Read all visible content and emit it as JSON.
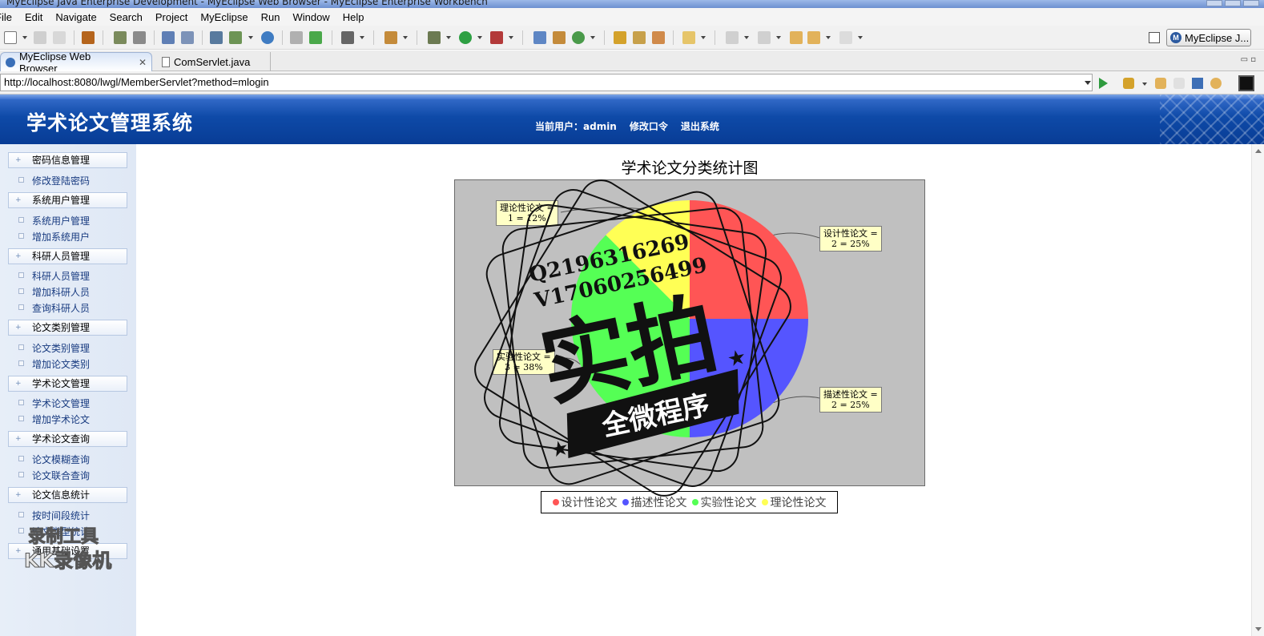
{
  "window": {
    "title": "MyEclipse Java Enterprise Development - MyEclipse Web Browser - MyEclipse Enterprise Workbench"
  },
  "menu": [
    "File",
    "Edit",
    "Navigate",
    "Search",
    "Project",
    "MyEclipse",
    "Run",
    "Window",
    "Help"
  ],
  "perspective": {
    "label": "MyEclipse J..."
  },
  "tabs": [
    {
      "label": "MyEclipse Web Browser",
      "close": "✕"
    },
    {
      "label": "ComServlet.java"
    }
  ],
  "address": {
    "url": "http://localhost:8080/lwgl/MemberServlet?method=mlogin"
  },
  "header": {
    "title": "学术论文管理系统",
    "current_user": "当前用户：admin",
    "change_password": "修改口令",
    "logout": "退出系统"
  },
  "sidebar": [
    {
      "group": "密码信息管理",
      "items": [
        "修改登陆密码"
      ]
    },
    {
      "group": "系统用户管理",
      "items": [
        "系统用户管理",
        "增加系统用户"
      ]
    },
    {
      "group": "科研人员管理",
      "items": [
        "科研人员管理",
        "增加科研人员",
        "查询科研人员"
      ]
    },
    {
      "group": "论文类别管理",
      "items": [
        "论文类别管理",
        "增加论文类别"
      ]
    },
    {
      "group": "学术论文管理",
      "items": [
        "学术论文管理",
        "增加学术论文"
      ]
    },
    {
      "group": "学术论文查询",
      "items": [
        "论文模糊查询",
        "论文联合查询"
      ]
    },
    {
      "group": "论文信息统计",
      "items": [
        "按时间段统计",
        "论文类型统计"
      ]
    },
    {
      "group": "通用基础设置",
      "items": []
    }
  ],
  "watermark": {
    "contact1": "Q2196316269",
    "contact2": "V17060256499",
    "big": "实拍",
    "banner": "全微程序",
    "corner1": "录制工具",
    "corner2": "KK录像机"
  },
  "chart_data": {
    "type": "pie",
    "title": "学术论文分类统计图",
    "categories": [
      "设计性论文",
      "描述性论文",
      "实验性论文",
      "理论性论文"
    ],
    "values": [
      2,
      2,
      3,
      1
    ],
    "percent_labels": [
      "2 = 25%",
      "2 = 25%",
      "3 = 38%",
      "1 = 12%"
    ],
    "colors": [
      "#ff5555",
      "#5555ff",
      "#55ff55",
      "#ffff55"
    ],
    "background": "#c0c0c0",
    "legend": "bottom"
  }
}
